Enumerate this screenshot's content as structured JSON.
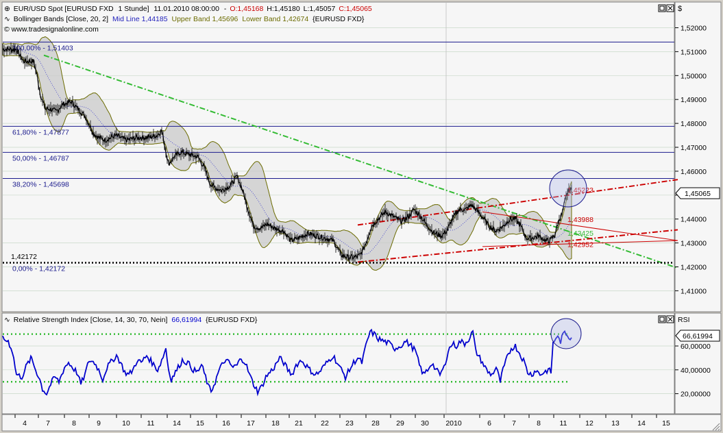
{
  "header": {
    "instrument": "EUR/USD Spot [EURUSD FXD",
    "timeframe": "1 Stunde]",
    "datetime": "11.01.2010 08:00:00",
    "sep": "-",
    "open": "O:1,45168",
    "high": "H:1,45180",
    "low": "L:1,45057",
    "close": "C:1,45065",
    "bb_name": "Bollinger Bands [Close, 20, 2]",
    "bb_mid": "Mid Line 1,44185",
    "bb_upper": "Upper Band 1,45696",
    "bb_lower": "Lower Band 1,42674",
    "bb_src": "{EURUSD FXD}",
    "watermark": "© www.tradesignalonline.com"
  },
  "rsi_header": {
    "label": "Relative Strength Index [Close, 14, 30, 70, Nein]",
    "value": "66,61994",
    "src": "{EURUSD FXD}"
  },
  "price_axis": {
    "currency": "$",
    "ticks": [
      "1,52000",
      "1,51000",
      "1,50000",
      "1,49000",
      "1,48000",
      "1,47000",
      "1,46000",
      "1,45000",
      "1,44000",
      "1,43000",
      "1,42000",
      "1,41000"
    ],
    "current": "1,45065"
  },
  "rsi_axis": {
    "label": "RSI",
    "ticks": [
      "60,00000",
      "40,00000",
      "20,00000"
    ],
    "current": "66,61994"
  },
  "fib_levels": [
    {
      "label": "100,00% - 1,51403",
      "value": 1.51403
    },
    {
      "label": "61,80% - 1,47877",
      "value": 1.47877
    },
    {
      "label": "50,00% - 1,46787",
      "value": 1.46787
    },
    {
      "label": "38,20% - 1,45698",
      "value": 1.45698
    },
    {
      "label": "0,00% - 1,42172",
      "value": 1.42172
    }
  ],
  "support_label": "1,42172",
  "annotations": [
    {
      "label": "1,45223",
      "value": 1.45223,
      "color": "#cc0000"
    },
    {
      "label": "1,43988",
      "value": 1.43988,
      "color": "#cc0000"
    },
    {
      "label": "1,43425",
      "value": 1.43425,
      "color": "#33bb33"
    },
    {
      "label": "1,42952",
      "value": 1.42952,
      "color": "#cc0000"
    }
  ],
  "x_axis": {
    "labels": [
      "4",
      "7",
      "8",
      "9",
      "10",
      "11",
      "14",
      "15",
      "16",
      "17",
      "18",
      "21",
      "22",
      "23",
      "28",
      "29",
      "30",
      "2010",
      "6",
      "7",
      "8",
      "11",
      "12",
      "13",
      "14",
      "15"
    ]
  },
  "colors": {
    "candle": "#000000",
    "band_fill": "#c8c8c8",
    "band_line": "#6b6b00",
    "fib": "#1a1a8c",
    "green": "#33bb33",
    "red": "#cc0000",
    "rsi": "#0000cc",
    "circle": "#1a1a8c"
  },
  "chart_data": {
    "type": "line",
    "title": "EUR/USD Spot [EURUSD FXD 1 Stunde]",
    "ylim": [
      1.405,
      1.525
    ],
    "price_path": [
      [
        0,
        1.511
      ],
      [
        20,
        1.511
      ],
      [
        30,
        1.506
      ],
      [
        45,
        1.506
      ],
      [
        50,
        1.5
      ],
      [
        55,
        1.492
      ],
      [
        62,
        1.486
      ],
      [
        70,
        1.486
      ],
      [
        78,
        1.485
      ],
      [
        88,
        1.488
      ],
      [
        100,
        1.489
      ],
      [
        110,
        1.486
      ],
      [
        120,
        1.483
      ],
      [
        127,
        1.479
      ],
      [
        132,
        1.476
      ],
      [
        140,
        1.474
      ],
      [
        150,
        1.473
      ],
      [
        165,
        1.475
      ],
      [
        180,
        1.473
      ],
      [
        195,
        1.474
      ],
      [
        210,
        1.474
      ],
      [
        225,
        1.475
      ],
      [
        232,
        1.477
      ],
      [
        236,
        1.471
      ],
      [
        242,
        1.463
      ],
      [
        250,
        1.466
      ],
      [
        260,
        1.468
      ],
      [
        272,
        1.467
      ],
      [
        285,
        1.466
      ],
      [
        295,
        1.461
      ],
      [
        302,
        1.455
      ],
      [
        310,
        1.453
      ],
      [
        320,
        1.452
      ],
      [
        332,
        1.454
      ],
      [
        342,
        1.458
      ],
      [
        350,
        1.452
      ],
      [
        358,
        1.444
      ],
      [
        366,
        1.437
      ],
      [
        376,
        1.436
      ],
      [
        386,
        1.438
      ],
      [
        398,
        1.436
      ],
      [
        410,
        1.435
      ],
      [
        420,
        1.431
      ],
      [
        432,
        1.432
      ],
      [
        445,
        1.434
      ],
      [
        458,
        1.433
      ],
      [
        470,
        1.432
      ],
      [
        482,
        1.431
      ],
      [
        494,
        1.425
      ],
      [
        504,
        1.424
      ],
      [
        514,
        1.424
      ],
      [
        522,
        1.425
      ],
      [
        530,
        1.43
      ],
      [
        538,
        1.437
      ],
      [
        548,
        1.44
      ],
      [
        558,
        1.443
      ],
      [
        570,
        1.441
      ],
      [
        582,
        1.439
      ],
      [
        592,
        1.441
      ],
      [
        600,
        1.444
      ],
      [
        610,
        1.441
      ],
      [
        620,
        1.437
      ],
      [
        630,
        1.434
      ],
      [
        640,
        1.433
      ],
      [
        648,
        1.435
      ],
      [
        656,
        1.44
      ],
      [
        666,
        1.444
      ],
      [
        676,
        1.444
      ],
      [
        684,
        1.446
      ],
      [
        694,
        1.443
      ],
      [
        702,
        1.44
      ],
      [
        710,
        1.437
      ],
      [
        720,
        1.435
      ],
      [
        730,
        1.437
      ],
      [
        740,
        1.44
      ],
      [
        748,
        1.44
      ],
      [
        756,
        1.437
      ],
      [
        764,
        1.432
      ],
      [
        772,
        1.432
      ],
      [
        782,
        1.433
      ],
      [
        792,
        1.431
      ],
      [
        798,
        1.431
      ],
      [
        805,
        1.433
      ],
      [
        808,
        1.436
      ],
      [
        812,
        1.44
      ],
      [
        816,
        1.442
      ],
      [
        820,
        1.447
      ],
      [
        825,
        1.452
      ],
      [
        830,
        1.452
      ]
    ],
    "rsi_path": [
      [
        0,
        66
      ],
      [
        8,
        64
      ],
      [
        14,
        56
      ],
      [
        20,
        36
      ],
      [
        28,
        34
      ],
      [
        35,
        44
      ],
      [
        42,
        50
      ],
      [
        48,
        40
      ],
      [
        54,
        32
      ],
      [
        58,
        24
      ],
      [
        64,
        20
      ],
      [
        70,
        28
      ],
      [
        76,
        34
      ],
      [
        82,
        30
      ],
      [
        90,
        42
      ],
      [
        96,
        46
      ],
      [
        102,
        42
      ],
      [
        108,
        38
      ],
      [
        114,
        28
      ],
      [
        120,
        36
      ],
      [
        126,
        48
      ],
      [
        134,
        46
      ],
      [
        140,
        40
      ],
      [
        146,
        32
      ],
      [
        152,
        42
      ],
      [
        160,
        48
      ],
      [
        166,
        52
      ],
      [
        172,
        46
      ],
      [
        178,
        38
      ],
      [
        184,
        36
      ],
      [
        190,
        40
      ],
      [
        196,
        48
      ],
      [
        202,
        46
      ],
      [
        210,
        52
      ],
      [
        218,
        46
      ],
      [
        226,
        40
      ],
      [
        232,
        48
      ],
      [
        238,
        58
      ],
      [
        242,
        40
      ],
      [
        246,
        32
      ],
      [
        250,
        36
      ],
      [
        256,
        42
      ],
      [
        262,
        48
      ],
      [
        270,
        46
      ],
      [
        278,
        40
      ],
      [
        284,
        38
      ],
      [
        290,
        44
      ],
      [
        296,
        34
      ],
      [
        300,
        26
      ],
      [
        304,
        22
      ],
      [
        310,
        30
      ],
      [
        316,
        40
      ],
      [
        324,
        48
      ],
      [
        330,
        46
      ],
      [
        336,
        42
      ],
      [
        342,
        44
      ],
      [
        348,
        50
      ],
      [
        354,
        46
      ],
      [
        360,
        36
      ],
      [
        366,
        28
      ],
      [
        372,
        22
      ],
      [
        378,
        26
      ],
      [
        384,
        34
      ],
      [
        390,
        38
      ],
      [
        396,
        42
      ],
      [
        404,
        50
      ],
      [
        410,
        46
      ],
      [
        416,
        40
      ],
      [
        422,
        36
      ],
      [
        428,
        44
      ],
      [
        436,
        48
      ],
      [
        442,
        44
      ],
      [
        448,
        40
      ],
      [
        456,
        36
      ],
      [
        462,
        38
      ],
      [
        470,
        44
      ],
      [
        476,
        48
      ],
      [
        482,
        52
      ],
      [
        488,
        46
      ],
      [
        494,
        40
      ],
      [
        500,
        34
      ],
      [
        506,
        40
      ],
      [
        512,
        46
      ],
      [
        518,
        50
      ],
      [
        524,
        46
      ],
      [
        530,
        60
      ],
      [
        536,
        72
      ],
      [
        542,
        70
      ],
      [
        548,
        66
      ],
      [
        556,
        64
      ],
      [
        564,
        62
      ],
      [
        572,
        58
      ],
      [
        580,
        60
      ],
      [
        588,
        64
      ],
      [
        596,
        60
      ],
      [
        602,
        56
      ],
      [
        608,
        44
      ],
      [
        614,
        36
      ],
      [
        620,
        40
      ],
      [
        626,
        46
      ],
      [
        632,
        40
      ],
      [
        638,
        36
      ],
      [
        644,
        42
      ],
      [
        650,
        56
      ],
      [
        656,
        62
      ],
      [
        662,
        60
      ],
      [
        668,
        64
      ],
      [
        674,
        62
      ],
      [
        680,
        66
      ],
      [
        686,
        72
      ],
      [
        690,
        56
      ],
      [
        696,
        50
      ],
      [
        702,
        44
      ],
      [
        708,
        38
      ],
      [
        714,
        36
      ],
      [
        720,
        42
      ],
      [
        726,
        30
      ],
      [
        730,
        40
      ],
      [
        736,
        50
      ],
      [
        742,
        58
      ],
      [
        748,
        60
      ],
      [
        754,
        54
      ],
      [
        760,
        48
      ],
      [
        766,
        38
      ],
      [
        772,
        36
      ],
      [
        778,
        40
      ],
      [
        784,
        36
      ],
      [
        790,
        38
      ],
      [
        796,
        40
      ],
      [
        800,
        38
      ],
      [
        803,
        62
      ],
      [
        808,
        68
      ],
      [
        814,
        64
      ],
      [
        820,
        72
      ],
      [
        826,
        68
      ],
      [
        830,
        67
      ]
    ],
    "rsi_levels": [
      70,
      30
    ],
    "green_trendline": [
      [
        60,
        1.5085
      ],
      [
        985,
        1.4195
      ]
    ],
    "red_upper_channel": [
      [
        518,
        1.4375
      ],
      [
        985,
        1.4565
      ]
    ],
    "red_lower_channel": [
      [
        518,
        1.422
      ],
      [
        985,
        1.4355
      ]
    ],
    "triangle_upper": [
      [
        700,
        1.443
      ],
      [
        985,
        1.431
      ]
    ],
    "triangle_lower": [
      [
        700,
        1.4285
      ],
      [
        985,
        1.431
      ]
    ],
    "support_line": 1.42172
  }
}
